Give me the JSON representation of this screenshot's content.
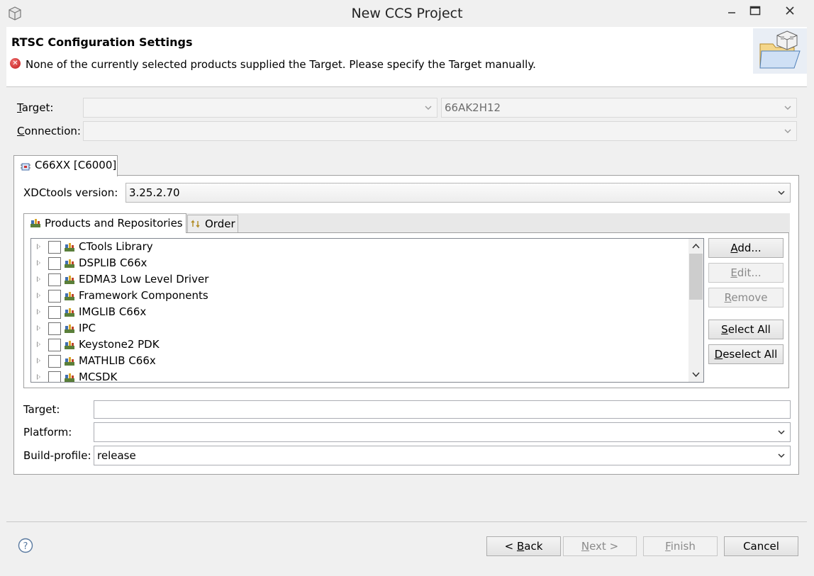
{
  "window": {
    "title": "New CCS Project"
  },
  "header": {
    "title": "RTSC Configuration Settings",
    "message": "None of the currently selected products supplied the Target. Please specify the Target manually."
  },
  "target_row": {
    "label": "Target:",
    "label_mnemonic": "T",
    "label_rest": "arget:",
    "primary_value": "",
    "secondary_value": "66AK2H12"
  },
  "connection_row": {
    "label": "Connection:",
    "label_mnemonic": "C",
    "label_rest": "onnection:",
    "value": ""
  },
  "device_tab": {
    "label": "C66XX [C6000]"
  },
  "xdctools": {
    "label": "XDCtools version:",
    "value": "3.25.2.70"
  },
  "inner_tabs": [
    {
      "label": "Products and Repositories",
      "selected": true
    },
    {
      "label": "Order",
      "selected": false
    }
  ],
  "products": [
    {
      "label": "CTools Library",
      "checked": false
    },
    {
      "label": "DSPLIB C66x",
      "checked": false
    },
    {
      "label": "EDMA3 Low Level Driver",
      "checked": false
    },
    {
      "label": "Framework Components",
      "checked": false
    },
    {
      "label": "IMGLIB C66x",
      "checked": false
    },
    {
      "label": "IPC",
      "checked": false
    },
    {
      "label": "Keystone2 PDK",
      "checked": false
    },
    {
      "label": "MATHLIB C66x",
      "checked": false
    },
    {
      "label": "MCSDK",
      "checked": false
    }
  ],
  "side_buttons": {
    "add": {
      "mn": "A",
      "rest": "dd..."
    },
    "edit": {
      "mn": "E",
      "rest": "dit..."
    },
    "remove": {
      "mn": "R",
      "rest": "emove"
    },
    "select_all": {
      "mn": "S",
      "rest": "elect All"
    },
    "deselect_all": {
      "mn": "D",
      "rest": "eselect All"
    }
  },
  "settings": {
    "target": {
      "label": "Target:",
      "value": ""
    },
    "platform": {
      "label": "Platform:",
      "value": ""
    },
    "build_profile": {
      "label": "Build-profile:",
      "value": "release"
    }
  },
  "footer": {
    "back": {
      "pre": "< ",
      "mn": "B",
      "rest": "ack"
    },
    "next": {
      "mn": "N",
      "rest": "ext >"
    },
    "finish": {
      "mn": "F",
      "rest": "inish"
    },
    "cancel": "Cancel"
  },
  "icons": [
    "app-icon",
    "minimize-icon",
    "maximize-icon",
    "close-icon",
    "error-icon",
    "wizard-banner-icon",
    "chip-icon",
    "package-icon",
    "order-icon",
    "help-icon",
    "chevron-down-icon",
    "scroll-up-icon",
    "scroll-down-icon"
  ],
  "colors": {
    "error": "#c01818",
    "window_bg": "#f0f0f0",
    "border": "#a0a0a0"
  }
}
